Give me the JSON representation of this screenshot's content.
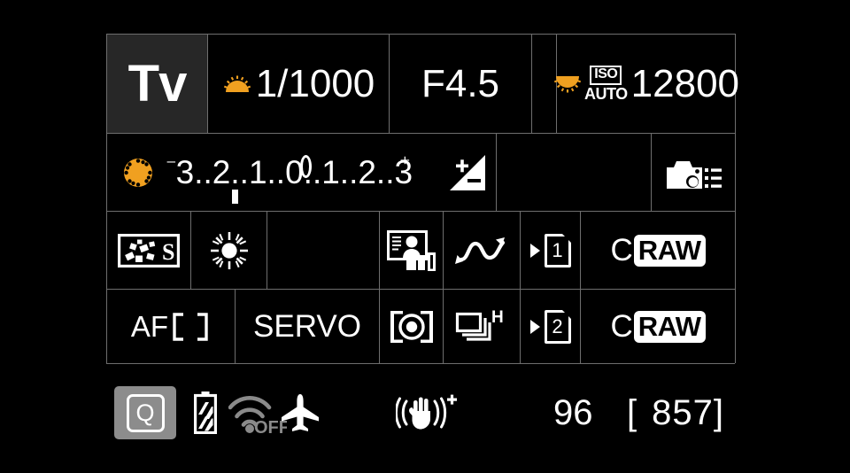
{
  "screen": {
    "device": "camera-quick-control-screen",
    "background": "#000000",
    "grid_line_color": "#6e6e6e",
    "accent_orange": "#F0A020",
    "highlight_bg": "#8c8c8c",
    "selected_cell_bg": "#272727"
  },
  "row1": {
    "shooting_mode": "Tv",
    "shutter_speed": "1/1000",
    "aperture": "F4.5",
    "iso_label": "ISO",
    "iso_auto": "AUTO",
    "iso_value": "12800",
    "shutter_icon": "shutter-dial-up-icon",
    "aperture_icon": "",
    "iso_icon": "iso-dial-down-icon"
  },
  "row2": {
    "dial_icon": "exposure-dial-icon",
    "scale": {
      "minus_sign": "⁻",
      "plus_sign": "⁺",
      "labels": "3..2..1..0..1..2..3",
      "full_text": "⁻3..2..1..0..1..2.⁺3",
      "range": [
        -3,
        3
      ],
      "pointer_value": 0,
      "tick_value": -1.7
    },
    "exposure_comp_icon": "exposure-compensation-icon",
    "custom_shooting_icon": "camera-settings-list-icon"
  },
  "row3": {
    "picture_style": "S",
    "picture_style_icon": "picture-style-icon",
    "white_balance_icon": "daylight-white-balance-icon",
    "auto_lighting_icon": "auto-lighting-optimizer-icon",
    "bracketing_icon": "exposure-bracketing-zigzag-icon",
    "card_arrow_icon": "record-arrow-icon",
    "card_slot": "1",
    "image_quality_c": "C",
    "image_quality_raw": "RAW"
  },
  "row4": {
    "af_area_label": "AF",
    "af_area_icon": "af-area-brackets-icon",
    "af_operation": "SERVO",
    "metering_icon": "evaluative-metering-icon",
    "drive_mode_icon": "continuous-high-drive-icon",
    "drive_mode_label": "H",
    "card_arrow_icon": "record-arrow-icon",
    "card_slot": "2",
    "image_quality_c": "C",
    "image_quality_raw": "RAW"
  },
  "status_bar": {
    "quick_control_label": "Q",
    "battery_icon": "battery-icon",
    "wifi_icon": "wifi-icon",
    "wifi_state": "OFF",
    "airplane_icon": "airplane-mode-icon",
    "stabilizer_icon": "image-stabilizer-icon",
    "stabilizer_plus": "+",
    "max_burst": "96",
    "shots_open_bracket": "[",
    "shots_remaining": "857",
    "shots_close_bracket": "]"
  }
}
